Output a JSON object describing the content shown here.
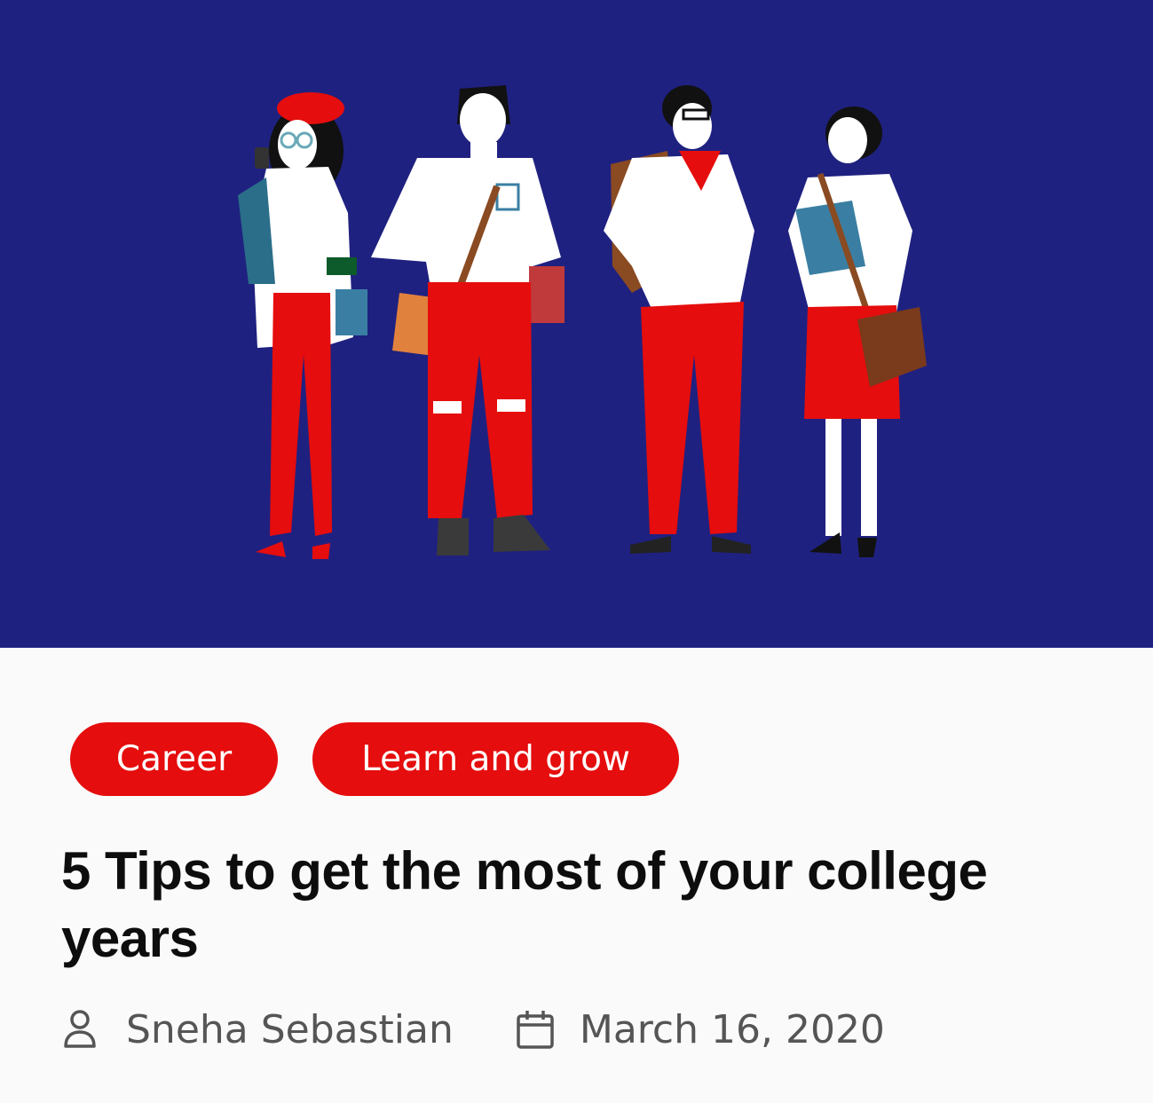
{
  "hero": {
    "image_name": "students-illustration",
    "background_color": "#1f2180",
    "accent_color": "#e50d0d"
  },
  "tags": [
    {
      "label": "Career"
    },
    {
      "label": "Learn and grow"
    }
  ],
  "article": {
    "title": "5 Tips to get the most of your college years",
    "author": "Sneha Sebastian",
    "date": "March 16, 2020",
    "author_icon": "person-icon",
    "date_icon": "calendar-icon"
  }
}
